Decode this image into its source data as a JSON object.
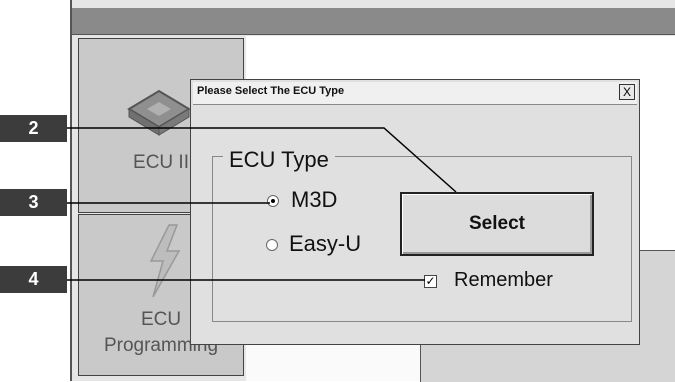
{
  "app": {
    "side_buttons": [
      {
        "label": "ECU II"
      },
      {
        "label": "ECU"
      },
      {
        "label": "Programming"
      }
    ]
  },
  "dialog": {
    "title": "Please Select The ECU Type",
    "close_label": "X",
    "group_label": "ECU Type",
    "options": [
      {
        "label": "M3D",
        "selected": true
      },
      {
        "label": "Easy-U",
        "selected": false
      }
    ],
    "select_label": "Select",
    "remember_label": "Remember",
    "remember_checked": true,
    "check_mark": "✓"
  },
  "callouts": [
    {
      "label": "2"
    },
    {
      "label": "3"
    },
    {
      "label": "4"
    }
  ]
}
